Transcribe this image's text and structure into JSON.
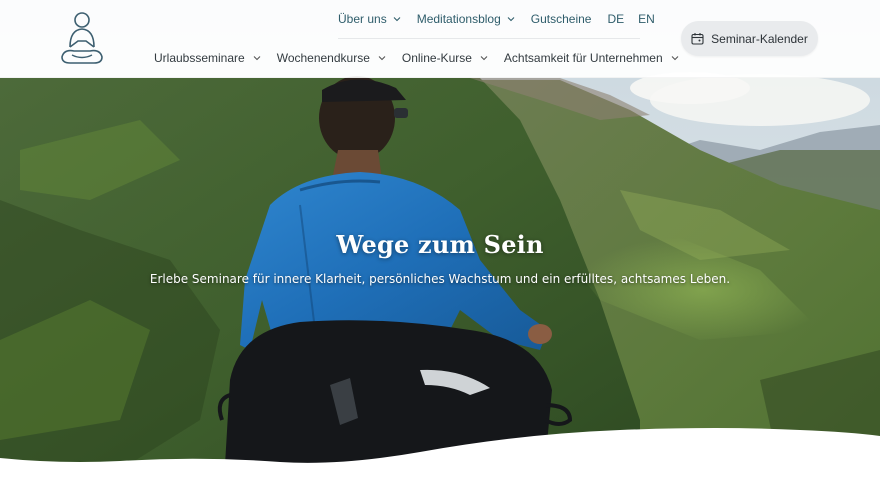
{
  "header": {
    "logo_icon": "meditating-person-icon",
    "top_nav": [
      {
        "label": "Über uns",
        "has_dropdown": true
      },
      {
        "label": "Meditationsblog",
        "has_dropdown": true
      },
      {
        "label": "Gutscheine",
        "has_dropdown": false
      }
    ],
    "languages": [
      "DE",
      "EN"
    ],
    "main_nav": [
      {
        "label": "Urlaubsseminare",
        "has_dropdown": true
      },
      {
        "label": "Wochenendkurse",
        "has_dropdown": true
      },
      {
        "label": "Online-Kurse",
        "has_dropdown": true
      },
      {
        "label": "Achtsamkeit für Unternehmen",
        "has_dropdown": true
      }
    ],
    "calendar_button": {
      "label": "Seminar-Kalender",
      "icon": "calendar-icon"
    }
  },
  "hero": {
    "title": "Wege zum Sein",
    "subtitle": "Erlebe Seminare für innere Klarheit, persönliches Wachstum und ein erfülltes, achtsames Leben."
  },
  "colors": {
    "nav_accent": "#2f5d6b",
    "nav_text": "#333b40",
    "button_bg": "#e9ebed"
  }
}
